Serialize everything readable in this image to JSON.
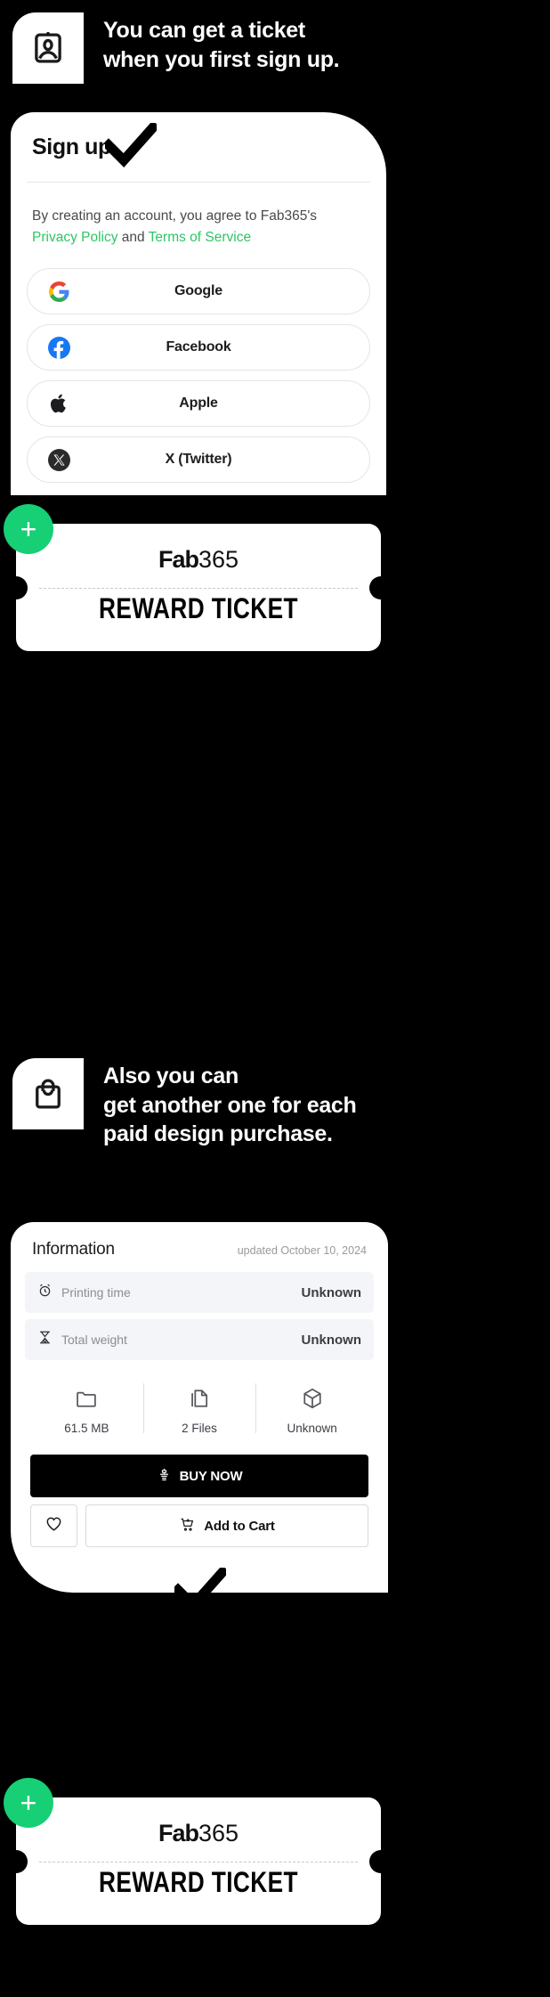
{
  "sections": [
    {
      "icon": "id-card-icon",
      "lines": [
        "You can get a ticket",
        "when you first sign up."
      ]
    },
    {
      "icon": "shopping-bag-icon",
      "lines": [
        "Also you can",
        "get another one for each",
        "paid design purchase."
      ]
    }
  ],
  "signup": {
    "title": "Sign up",
    "agreement_prefix": "By creating an account, you agree to Fab365's ",
    "privacy_link": "Privacy Policy",
    "agreement_middle": " and ",
    "terms_link": "Terms of Service",
    "providers": [
      {
        "label": "Google",
        "icon": "google-icon"
      },
      {
        "label": "Facebook",
        "icon": "facebook-icon"
      },
      {
        "label": "Apple",
        "icon": "apple-icon"
      },
      {
        "label": "X (Twitter)",
        "icon": "x-twitter-icon"
      }
    ],
    "link_color": "#2dc664"
  },
  "ticket": {
    "brand_word": "Fab",
    "brand_number": "365",
    "name": "REWARD TICKET",
    "plus": "+",
    "badge_color": "#17cf75"
  },
  "information": {
    "title": "Information",
    "updated": "updated October 10, 2024",
    "specs": [
      {
        "label": "Printing time",
        "value": "Unknown",
        "icon": "alarm-clock-icon"
      },
      {
        "label": "Total weight",
        "value": "Unknown",
        "icon": "weight-scale-icon"
      }
    ],
    "stats": [
      {
        "label": "61.5 MB",
        "icon": "folder-icon"
      },
      {
        "label": "2 Files",
        "icon": "files-icon"
      },
      {
        "label": "Unknown",
        "icon": "cube-icon"
      }
    ],
    "buy_label": "BUY NOW",
    "cart_label": "Add to Cart",
    "buy_icon": "3d-printer-icon",
    "cart_icon": "cart-plus-icon",
    "wish_icon": "heart-icon"
  }
}
